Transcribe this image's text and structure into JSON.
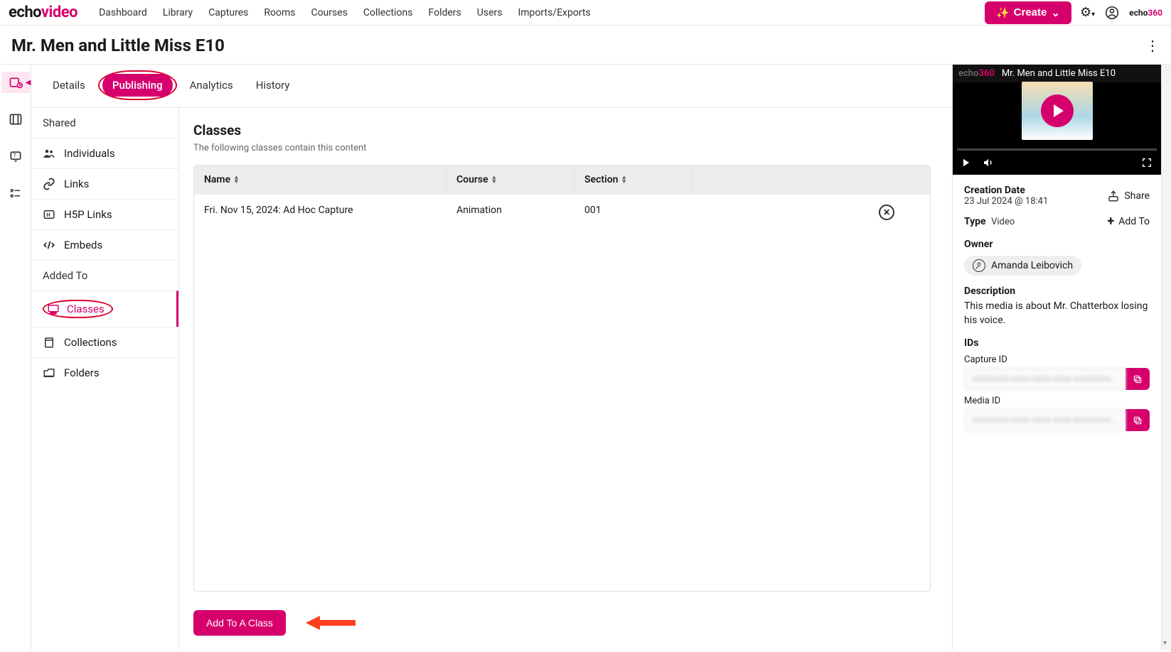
{
  "logo": {
    "echo": "echo",
    "video": "video"
  },
  "nav": {
    "dashboard": "Dashboard",
    "library": "Library",
    "captures": "Captures",
    "rooms": "Rooms",
    "courses": "Courses",
    "collections": "Collections",
    "folders": "Folders",
    "users": "Users",
    "imports": "Imports/Exports"
  },
  "create_label": "Create",
  "brand_mini": {
    "e": "echo",
    "n": "360"
  },
  "page_title": "Mr. Men and Little Miss E10",
  "tabs": {
    "details": "Details",
    "publishing": "Publishing",
    "analytics": "Analytics",
    "history": "History"
  },
  "shared_label": "Shared",
  "side": {
    "individuals": "Individuals",
    "links": "Links",
    "h5p": "H5P Links",
    "embeds": "Embeds"
  },
  "added_to_label": "Added To",
  "added": {
    "classes": "Classes",
    "collections": "Collections",
    "folders": "Folders"
  },
  "classes": {
    "heading": "Classes",
    "sub": "The following classes contain this content",
    "cols": {
      "name": "Name",
      "course": "Course",
      "section": "Section"
    },
    "rows": [
      {
        "name": "Fri. Nov 15, 2024: Ad Hoc Capture",
        "course": "Animation",
        "section": "001"
      }
    ],
    "add_btn": "Add To A Class"
  },
  "video_title": "Mr. Men and Little Miss E10",
  "video_logo": {
    "e": "echo",
    "n": "360"
  },
  "meta": {
    "creation_label": "Creation Date",
    "creation_val": "23 Jul 2024 @ 18:41",
    "share": "Share",
    "type_label": "Type",
    "type_val": "Video",
    "addto": "Add To",
    "owner_label": "Owner",
    "owner_name": "Amanda Leibovich",
    "desc_label": "Description",
    "desc": "This media is about Mr. Chatterbox losing his voice.",
    "ids_label": "IDs",
    "capture_label": "Capture ID",
    "media_label": "Media ID",
    "capture_val": "xxxxxxxx-xxxx-xxxx-xxxx-xxxxxxxx…",
    "media_val": "xxxxxxxx-xxxx-xxxx-xxxx-xxxxxxxx…"
  }
}
